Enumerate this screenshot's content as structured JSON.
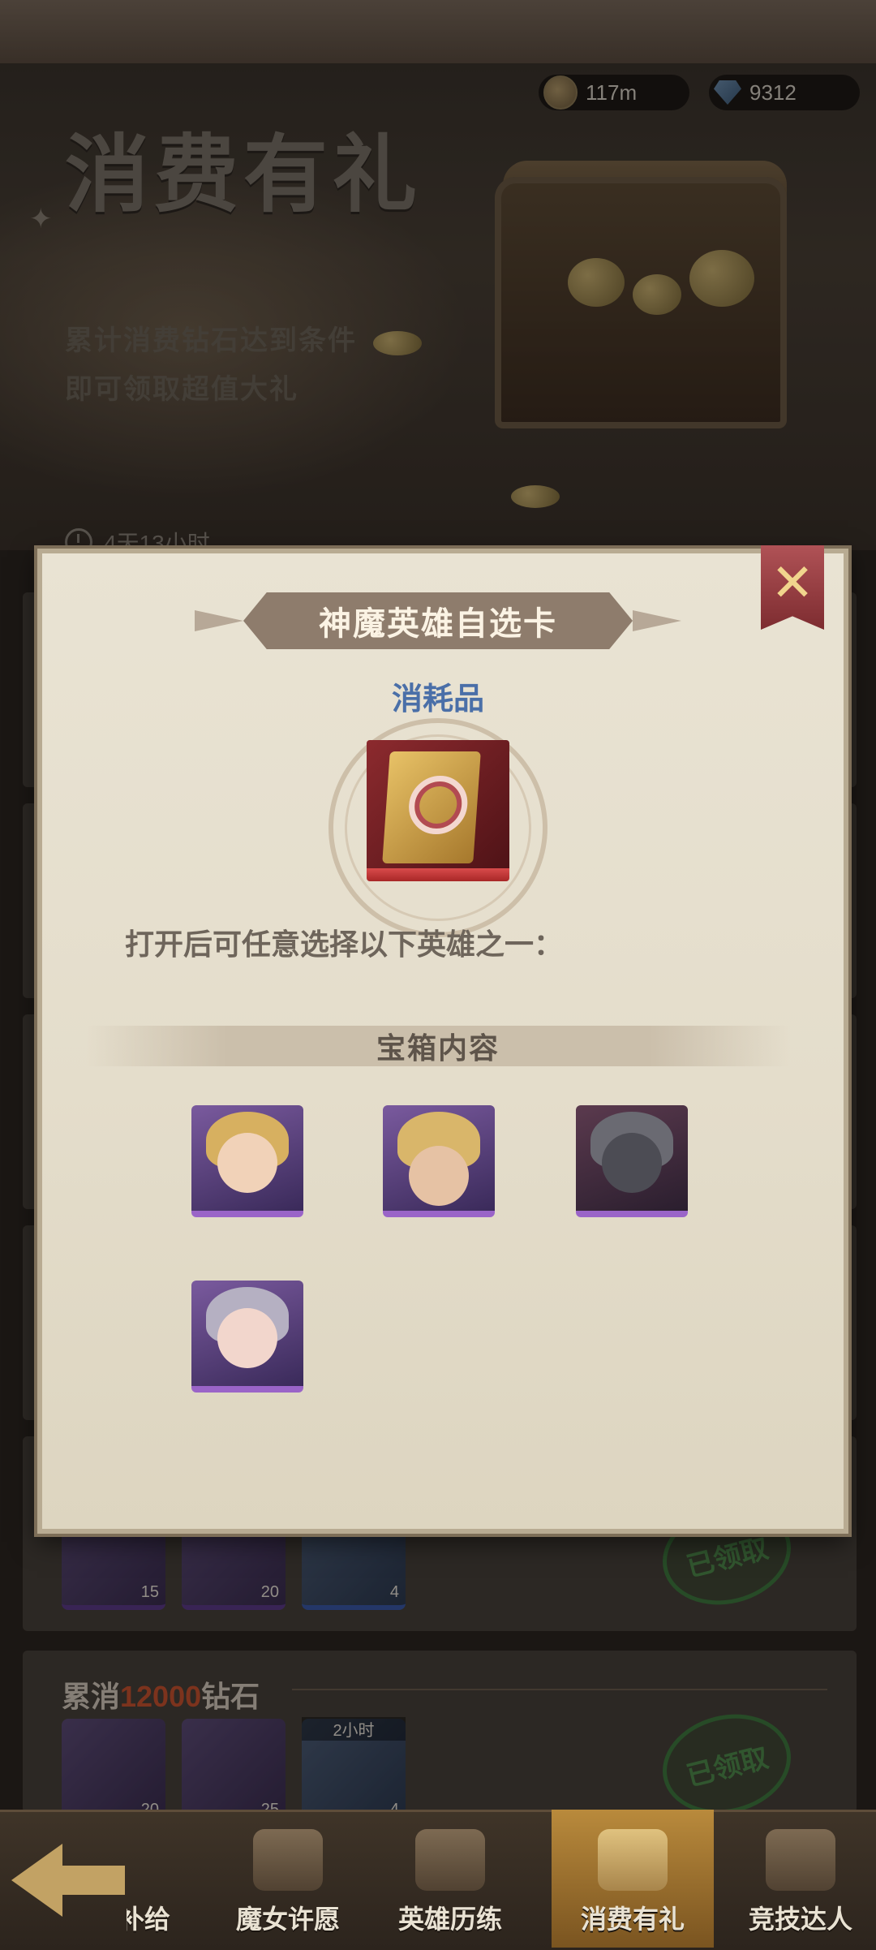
{
  "currencies": {
    "coins": "117m",
    "gems": "9312"
  },
  "banner": {
    "title": "消费有礼",
    "subtitle_line1": "累计消费钻石达到条件",
    "subtitle_line2": "即可领取超值大礼",
    "timer": "4天13小时"
  },
  "modal": {
    "title": "神魔英雄自选卡",
    "item_type": "消耗品",
    "description": "打开后可任意选择以下英雄之一：",
    "section_title": "宝箱内容",
    "close_icon": "close-x-icon",
    "heroes": [
      {
        "name": "golden-mage-portrait"
      },
      {
        "name": "blonde-swordsman-portrait"
      },
      {
        "name": "dark-armored-knight-portrait"
      },
      {
        "name": "horned-sorceress-portrait"
      }
    ]
  },
  "reward_rows": [
    {
      "items": [
        {
          "icon": "purple-rune-icon",
          "count": "15"
        },
        {
          "icon": "purple-flame-icon",
          "count": "20"
        },
        {
          "icon": "crystal-dust-icon",
          "count": "4"
        }
      ],
      "status": "已领取"
    },
    {
      "title_prefix": "累消",
      "title_number": "12000",
      "title_suffix": "钻石",
      "items": [
        {
          "icon": "purple-rune-icon",
          "count": "20"
        },
        {
          "icon": "purple-flame-icon",
          "count": "25"
        },
        {
          "icon": "crystal-dust-icon",
          "count": "4",
          "timer": "2小时"
        }
      ],
      "status": "已领取"
    }
  ],
  "nav": [
    {
      "label": "补给",
      "icon": "supply-icon"
    },
    {
      "label": "魔女许愿",
      "icon": "wish-icon"
    },
    {
      "label": "英雄历练",
      "icon": "scroll-icon"
    },
    {
      "label": "消费有礼",
      "icon": "gift-box-icon",
      "active": true
    },
    {
      "label": "竞技达人",
      "icon": "crossed-swords-icon"
    }
  ],
  "colors": {
    "accent_red": "#c8532f",
    "item_type_blue": "#4a6fa8",
    "rarity_purple": "#9a64c8",
    "claimed_green": "#4f8b4c"
  }
}
